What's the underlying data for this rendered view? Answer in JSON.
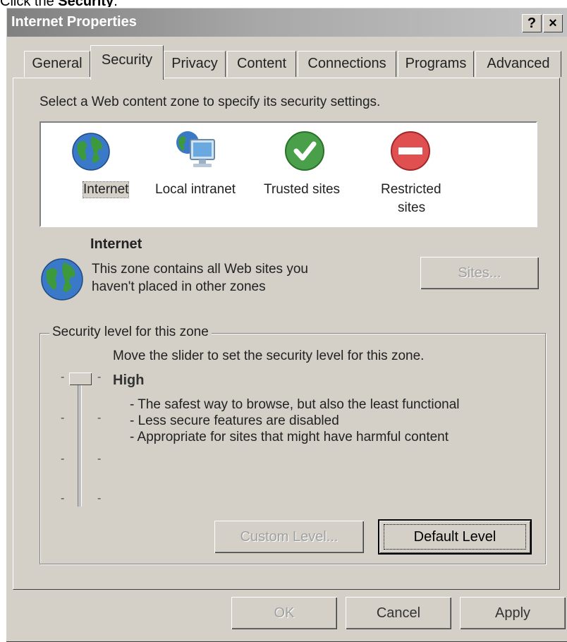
{
  "caption": {
    "prefix": "Click the ",
    "bold": "Security"
  },
  "window": {
    "title": "Internet Properties",
    "help_button": "?",
    "close_button": "×"
  },
  "tabs": [
    {
      "label": "General"
    },
    {
      "label": "Security"
    },
    {
      "label": "Privacy"
    },
    {
      "label": "Content"
    },
    {
      "label": "Connections"
    },
    {
      "label": "Programs"
    },
    {
      "label": "Advanced"
    }
  ],
  "security": {
    "instruction": "Select a Web content zone to specify its security settings.",
    "zones": [
      {
        "label": "Internet",
        "icon": "globe-icon"
      },
      {
        "label": "Local intranet",
        "icon": "intranet-icon"
      },
      {
        "label": "Trusted sites",
        "icon": "checkmark-icon",
        "color": "#4aa04a"
      },
      {
        "label": "Restricted sites",
        "label_line1": "Restricted",
        "label_line2": "sites",
        "icon": "no-entry-icon",
        "color": "#e05050"
      }
    ],
    "selected_zone": {
      "name": "Internet",
      "description_line1": "This zone contains all Web sites you",
      "description_line2": "haven't placed in other zones"
    },
    "sites_button": "Sites...",
    "group_title": "Security level for this zone",
    "slider_hint": "Move the slider to set the security level for this zone.",
    "level": {
      "name": "High",
      "descriptions": [
        "- The safest way to browse, but also the least functional",
        "- Less secure features are disabled",
        "- Appropriate for sites that might have harmful content"
      ]
    },
    "custom_level_button": "Custom Level...",
    "default_level_button": "Default Level"
  },
  "footer": {
    "ok": "OK",
    "cancel": "Cancel",
    "apply": "Apply"
  }
}
